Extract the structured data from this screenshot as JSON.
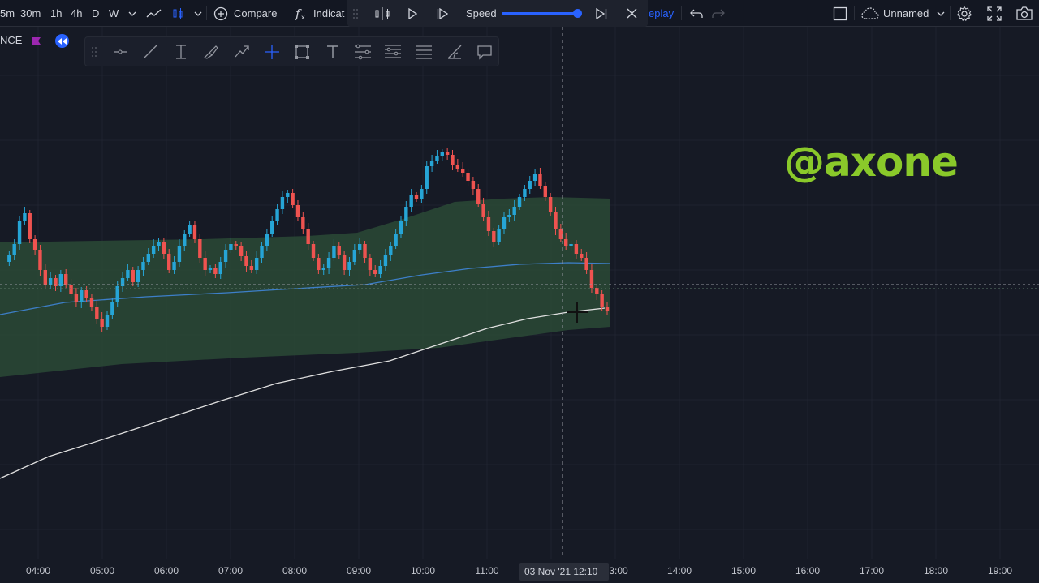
{
  "toolbar": {
    "intervals": [
      "5m",
      "30m",
      "1h",
      "4h",
      "D",
      "W"
    ],
    "compare_label": "Compare",
    "indicators_label": "Indicat",
    "replay_label": "eplay",
    "layout_name": "Unnamed",
    "speed_label": "Speed",
    "speed_level": 1.0
  },
  "symbol": {
    "exchange_text": "NCE"
  },
  "chart": {
    "watermark": "@axone",
    "colors": {
      "up": "#26a5d6",
      "down": "#ef5350",
      "band": "#2a4a36",
      "ma_blue": "#3d7fc9",
      "ma_white": "#e0e0e0",
      "accent": "#2962ff",
      "watermark": "#8ac92a"
    }
  },
  "time_axis": {
    "ticks": [
      "04:00",
      "05:00",
      "06:00",
      "07:00",
      "08:00",
      "09:00",
      "10:00",
      "11:00",
      "3:00",
      "14:00",
      "15:00",
      "16:00",
      "17:00",
      "18:00",
      "19:00"
    ],
    "crosshair_label": "03 Nov '21  12:10"
  },
  "icons": [
    "chart-type-icon",
    "compare-icon",
    "indicators-icon",
    "replay-select-bar-icon",
    "play-icon",
    "step-forward-icon",
    "jump-to-realtime-icon",
    "close-icon",
    "undo-icon",
    "redo-icon",
    "fullscreen-box-icon",
    "cloud-icon",
    "settings-icon",
    "fullscreen-icon",
    "camera-icon"
  ]
}
